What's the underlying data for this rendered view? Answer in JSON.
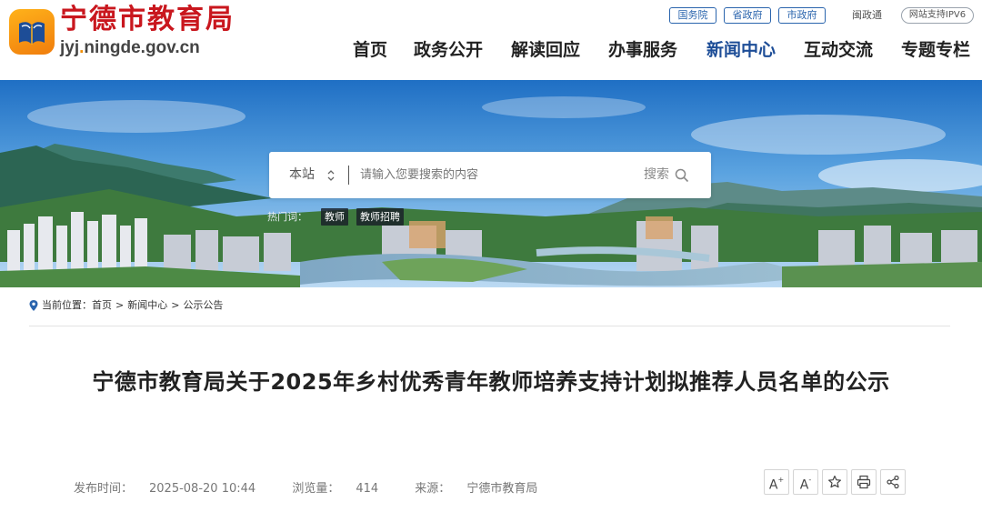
{
  "header": {
    "site_name": "宁德市教育局",
    "domain_prefix": "jyj",
    "domain_rest": "ningde.gov.cn",
    "top_links": [
      {
        "label": "国务院"
      },
      {
        "label": "省政府"
      },
      {
        "label": "市政府"
      }
    ],
    "minzhengtong": "闽政通",
    "ipv6": "网站支持IPV6"
  },
  "nav": [
    {
      "label": "首页"
    },
    {
      "label": "政务公开"
    },
    {
      "label": "解读回应"
    },
    {
      "label": "办事服务"
    },
    {
      "label": "新闻中心",
      "active": true
    },
    {
      "label": "互动交流"
    },
    {
      "label": "专题专栏"
    }
  ],
  "search": {
    "scope": "本站",
    "placeholder": "请输入您要搜索的内容",
    "button_label": "搜索",
    "hot_label": "热门词：",
    "hot_words": [
      "教师",
      "教师招聘"
    ]
  },
  "breadcrumb": {
    "label": "当前位置：",
    "items": [
      "首页",
      "新闻中心",
      "公示公告"
    ]
  },
  "article": {
    "title": "宁德市教育局关于2025年乡村优秀青年教师培养支持计划拟推荐人员名单的公示",
    "publish_label": "发布时间：",
    "publish_time": "2025-08-20 10:44",
    "views_label": "浏览量：",
    "views": "414",
    "source_label": "来源：",
    "source": "宁德市教育局"
  },
  "tools": {
    "font_larger": "A",
    "font_smaller": "A"
  },
  "colors": {
    "brand_red": "#c9171e",
    "nav_active": "#1d4d97",
    "link_blue": "#2a64ad",
    "logo_orange": "#f08c00"
  },
  "icons": [
    "book-logo-icon",
    "select-arrows-icon",
    "search-icon",
    "location-pin-icon",
    "star-icon",
    "print-icon",
    "share-icon"
  ]
}
